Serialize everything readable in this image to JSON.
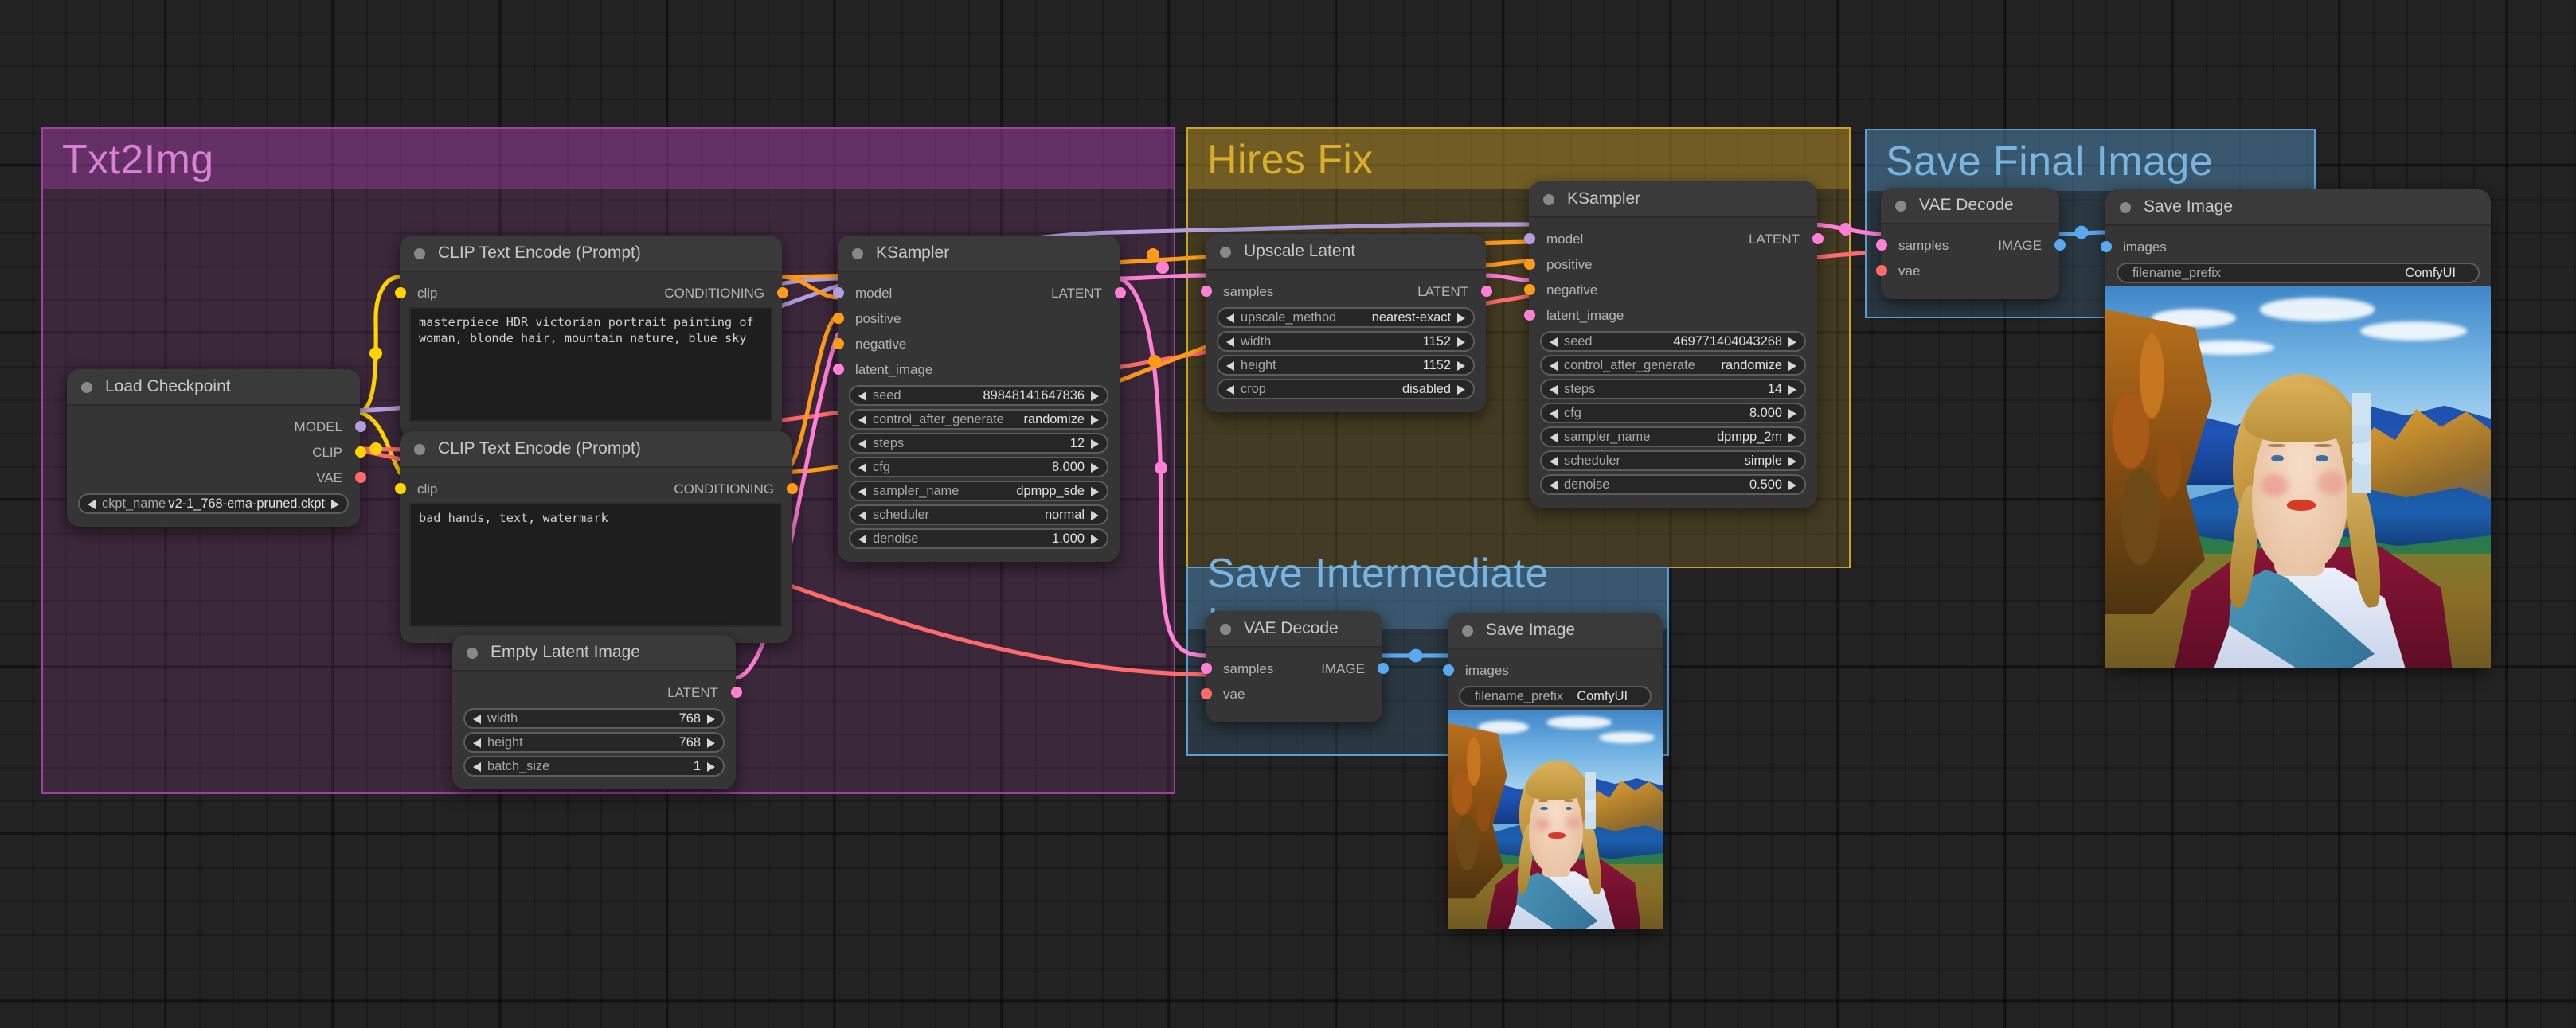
{
  "app": "ComfyUI",
  "groups": [
    {
      "id": "txt2img",
      "title": "Txt2Img",
      "color": "#a23fa2"
    },
    {
      "id": "hires",
      "title": "Hires Fix",
      "color": "#c9a227"
    },
    {
      "id": "final",
      "title": "Save Final Image",
      "color": "#5a9fd4"
    },
    {
      "id": "intermediate",
      "title": "Save Intermediate Image",
      "color": "#5a9fd4"
    }
  ],
  "nodes": {
    "load_checkpoint": {
      "title": "Load Checkpoint",
      "outputs": [
        {
          "label": "MODEL",
          "type": "MODEL"
        },
        {
          "label": "CLIP",
          "type": "CLIP"
        },
        {
          "label": "VAE",
          "type": "VAE"
        }
      ],
      "widgets": [
        {
          "name": "ckpt_name",
          "value": "v2-1_768-ema-pruned.ckpt"
        }
      ]
    },
    "clip_positive": {
      "title": "CLIP Text Encode (Prompt)",
      "input": {
        "label": "clip",
        "type": "CLIP"
      },
      "output": {
        "label": "CONDITIONING",
        "type": "CONDITIONING"
      },
      "text": "masterpiece HDR victorian portrait painting of woman, blonde hair, mountain nature, blue sky"
    },
    "clip_negative": {
      "title": "CLIP Text Encode (Prompt)",
      "input": {
        "label": "clip",
        "type": "CLIP"
      },
      "output": {
        "label": "CONDITIONING",
        "type": "CONDITIONING"
      },
      "text": "bad hands, text, watermark"
    },
    "empty_latent": {
      "title": "Empty Latent Image",
      "output": {
        "label": "LATENT",
        "type": "LATENT"
      },
      "widgets": [
        {
          "name": "width",
          "value": "768"
        },
        {
          "name": "height",
          "value": "768"
        },
        {
          "name": "batch_size",
          "value": "1"
        }
      ]
    },
    "ksampler_1": {
      "title": "KSampler",
      "inputs": [
        {
          "label": "model",
          "type": "MODEL"
        },
        {
          "label": "positive",
          "type": "CONDITIONING"
        },
        {
          "label": "negative",
          "type": "CONDITIONING"
        },
        {
          "label": "latent_image",
          "type": "LATENT"
        }
      ],
      "output": {
        "label": "LATENT",
        "type": "LATENT"
      },
      "widgets": [
        {
          "name": "seed",
          "value": "89848141647836"
        },
        {
          "name": "control_after_generate",
          "value": "randomize"
        },
        {
          "name": "steps",
          "value": "12"
        },
        {
          "name": "cfg",
          "value": "8.000"
        },
        {
          "name": "sampler_name",
          "value": "dpmpp_sde"
        },
        {
          "name": "scheduler",
          "value": "normal"
        },
        {
          "name": "denoise",
          "value": "1.000"
        }
      ]
    },
    "upscale_latent": {
      "title": "Upscale Latent",
      "input": {
        "label": "samples",
        "type": "LATENT"
      },
      "output": {
        "label": "LATENT",
        "type": "LATENT"
      },
      "widgets": [
        {
          "name": "upscale_method",
          "value": "nearest-exact"
        },
        {
          "name": "width",
          "value": "1152"
        },
        {
          "name": "height",
          "value": "1152"
        },
        {
          "name": "crop",
          "value": "disabled"
        }
      ]
    },
    "ksampler_2": {
      "title": "KSampler",
      "inputs": [
        {
          "label": "model",
          "type": "MODEL"
        },
        {
          "label": "positive",
          "type": "CONDITIONING"
        },
        {
          "label": "negative",
          "type": "CONDITIONING"
        },
        {
          "label": "latent_image",
          "type": "LATENT"
        }
      ],
      "output": {
        "label": "LATENT",
        "type": "LATENT"
      },
      "widgets": [
        {
          "name": "seed",
          "value": "469771404043268"
        },
        {
          "name": "control_after_generate",
          "value": "randomize"
        },
        {
          "name": "steps",
          "value": "14"
        },
        {
          "name": "cfg",
          "value": "8.000"
        },
        {
          "name": "sampler_name",
          "value": "dpmpp_2m"
        },
        {
          "name": "scheduler",
          "value": "simple"
        },
        {
          "name": "denoise",
          "value": "0.500"
        }
      ]
    },
    "vae_decode_final": {
      "title": "VAE Decode",
      "inputs": [
        {
          "label": "samples",
          "type": "LATENT"
        },
        {
          "label": "vae",
          "type": "VAE"
        }
      ],
      "output": {
        "label": "IMAGE",
        "type": "IMAGE"
      }
    },
    "save_image_final": {
      "title": "Save Image",
      "input": {
        "label": "images",
        "type": "IMAGE"
      },
      "widgets": [
        {
          "name": "filename_prefix",
          "value": "ComfyUI"
        }
      ]
    },
    "vae_decode_inter": {
      "title": "VAE Decode",
      "inputs": [
        {
          "label": "samples",
          "type": "LATENT"
        },
        {
          "label": "vae",
          "type": "VAE"
        }
      ],
      "output": {
        "label": "IMAGE",
        "type": "IMAGE"
      }
    },
    "save_image_inter": {
      "title": "Save Image",
      "input": {
        "label": "images",
        "type": "IMAGE"
      },
      "widgets": [
        {
          "name": "filename_prefix",
          "value": "ComfyUI"
        }
      ]
    }
  },
  "link_colors": {
    "MODEL": "#b39ddb",
    "CLIP": "#ffd500",
    "VAE": "#ff6b6b",
    "CONDITIONING": "#ff9b1a",
    "LATENT": "#ff80d5",
    "IMAGE": "#5aa9f0"
  }
}
